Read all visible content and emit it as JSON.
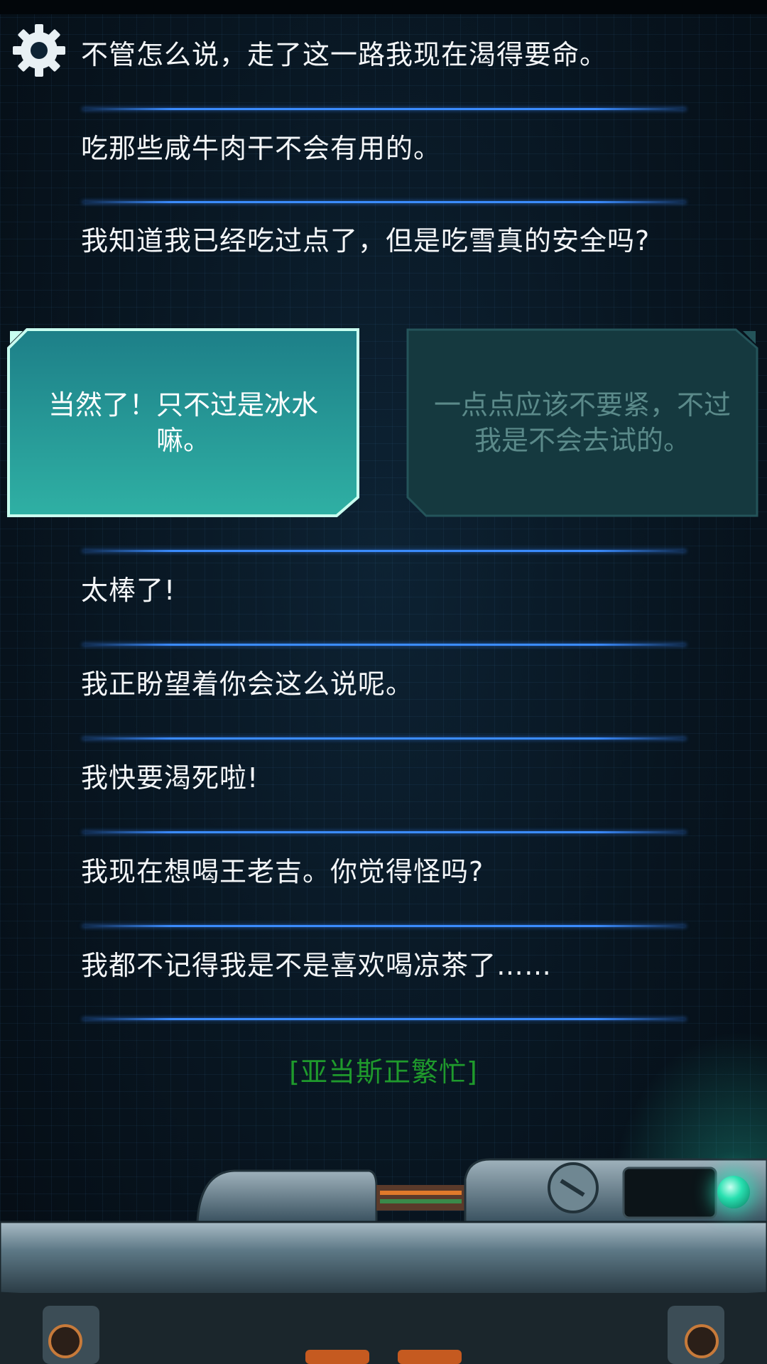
{
  "messages": [
    "不管怎么说，走了这一路我现在渴得要命。",
    "吃那些咸牛肉干不会有用的。",
    "我知道我已经吃过点了，但是吃雪真的安全吗?",
    "太棒了!",
    "我正盼望着你会这么说呢。",
    "我快要渴死啦!",
    "我现在想喝王老吉。你觉得怪吗?",
    "我都不记得我是不是喜欢喝凉茶了……"
  ],
  "choices": {
    "a": "当然了！只不过是冰水嘛。",
    "b": "一点点应该不要紧，不过我是不会去试的。"
  },
  "status": "[亚当斯正繁忙]",
  "icons": {
    "settings": "gear-icon",
    "indicator": "status-led"
  },
  "colors": {
    "accent": "#3b8cff",
    "choice_active": "#2a9c9a",
    "status": "#1f9a2c"
  }
}
